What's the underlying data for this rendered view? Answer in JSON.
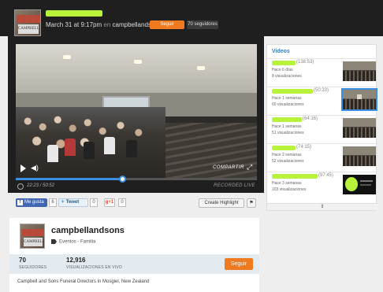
{
  "header": {
    "timestamp": "March 31 at 9:17pm",
    "on_word": "en",
    "channel": "campbellandsons",
    "follow_label": "Seguir",
    "followers_label": "70 seguidores"
  },
  "logo": {
    "sign_text": "CAMPBELL"
  },
  "player": {
    "share_label": "COMPARTIR",
    "time_label": "22:23 / 50:52",
    "recorded_label": "RECORDED LIVE",
    "progress_fraction": 0.44
  },
  "social": {
    "like_label": "Me gusta",
    "like_count": "6",
    "tweet_label": "Tweet",
    "tweet_count": "0",
    "gplus_label": "g+1",
    "gplus_count": "0",
    "highlight_label": "Create Highlight",
    "flag_label": "⚑"
  },
  "channel_card": {
    "name": "campbellandsons",
    "category": "Eventos - Familia",
    "followers_count": "70",
    "followers_label": "SEGUIDORES",
    "views_count": "12,916",
    "views_label": "VISUALIZACIONES EN VIVO",
    "follow_label": "Seguir",
    "description": "Campbell and Sons Funeral Directors in Mosgiel, New Zealand"
  },
  "videos": {
    "title": "Videos",
    "items": [
      {
        "duration": "(138:53)",
        "ago": "Hace 6 días",
        "views": "8 visualizaciones"
      },
      {
        "duration": "(50:33)",
        "ago": "Hace 1 semanas",
        "views": "60 visualizaciones"
      },
      {
        "duration": "(64:16)",
        "ago": "Hace 1 semanas",
        "views": "51 visualizaciones"
      },
      {
        "duration": "(74:15)",
        "ago": "Hace 2 semanas",
        "views": "52 visualizaciones"
      },
      {
        "duration": "(97:45)",
        "ago": "Hace 3 semanas",
        "views": "103 visualizaciones"
      }
    ],
    "more_label": "⇕"
  }
}
